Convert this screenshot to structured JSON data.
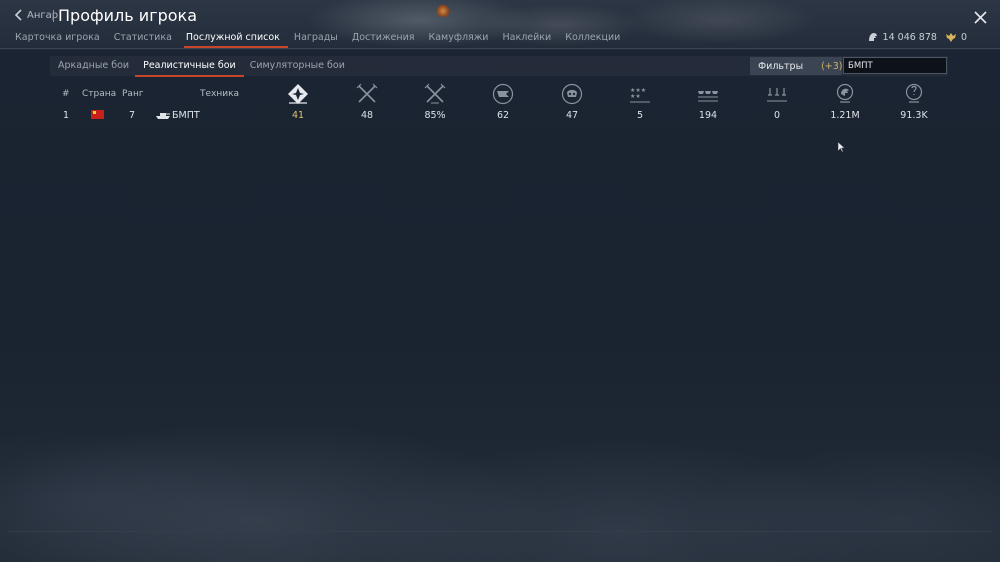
{
  "header": {
    "back_label": "Ангар",
    "title": "Профиль игрока",
    "silver": "14 046 878",
    "gold": "0"
  },
  "tabs": [
    {
      "label": "Карточка игрока",
      "active": false
    },
    {
      "label": "Статистика",
      "active": false
    },
    {
      "label": "Послужной список",
      "active": true
    },
    {
      "label": "Награды",
      "active": false
    },
    {
      "label": "Достижения",
      "active": false
    },
    {
      "label": "Камуфляжи",
      "active": false
    },
    {
      "label": "Наклейки",
      "active": false
    },
    {
      "label": "Коллекции",
      "active": false
    }
  ],
  "modes": [
    {
      "label": "Аркадные бои",
      "active": false
    },
    {
      "label": "Реалистичные бои",
      "active": true
    },
    {
      "label": "Симуляторные бои",
      "active": false
    }
  ],
  "filter": {
    "label": "Фильтры",
    "count": "(+3)",
    "search_value": "БМПТ"
  },
  "table": {
    "columns": {
      "index": "#",
      "country": "Страна",
      "rank": "Ранг",
      "vehicle": "Техника"
    },
    "stat_icons": [
      "battles-icon",
      "victories-icon",
      "win-rate-icon",
      "respawns-icon",
      "deaths-icon",
      "air-kills-icon",
      "ground-kills-icon",
      "naval-kills-icon",
      "score-icon",
      "research-icon"
    ],
    "row": {
      "index": "1",
      "country": "ussr-flag-icon",
      "rank": "7",
      "vehicle_icon": "tank-icon",
      "vehicle": "БМПТ",
      "stats": [
        "41",
        "48",
        "85%",
        "62",
        "47",
        "5",
        "194",
        "0",
        "1.21M",
        "91.3K"
      ]
    }
  },
  "colors": {
    "accent": "#c8452b",
    "background": "#1c2533",
    "highlight_value": "#e0c070"
  }
}
